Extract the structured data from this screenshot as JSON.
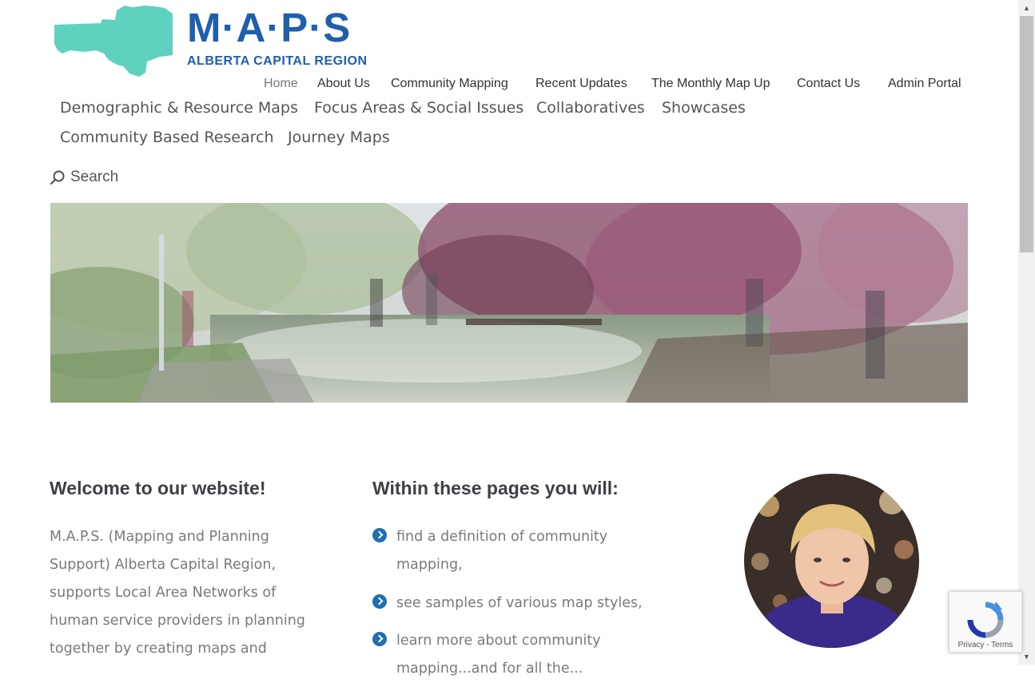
{
  "logo": {
    "title": "M·A·P·S",
    "subtitle": "ALBERTA CAPITAL REGION"
  },
  "top_nav": [
    "Home",
    "About Us",
    "Community Mapping",
    "Recent Updates",
    "The Monthly Map Up",
    "Contact Us",
    "Admin Portal"
  ],
  "main_nav": [
    "Demographic & Resource Maps",
    "Focus Areas & Social Issues",
    "Collaboratives",
    "Showcases",
    "Community Based Research",
    "Journey Maps"
  ],
  "search": {
    "label": "Search",
    "icon": "search-icon"
  },
  "welcome": {
    "heading": "Welcome to our website!",
    "lines": [
      "M.A.P.S. (Mapping and Planning",
      "Support) Alberta Capital Region,",
      "supports Local Area Networks of",
      "human service providers in planning",
      "together by creating maps and"
    ]
  },
  "within": {
    "heading": "Within these pages you will:",
    "items": [
      [
        "find a definition of community",
        "mapping,"
      ],
      [
        "see samples of various map styles,"
      ],
      [
        "learn more about community",
        "mapping...and for all the..."
      ]
    ]
  },
  "recaptcha": {
    "links": "Privacy - Terms"
  },
  "colors": {
    "brand_blue": "#1f5fad",
    "logo_teal": "#5fd1bf",
    "bullet_blue": "#1f6fb2"
  }
}
